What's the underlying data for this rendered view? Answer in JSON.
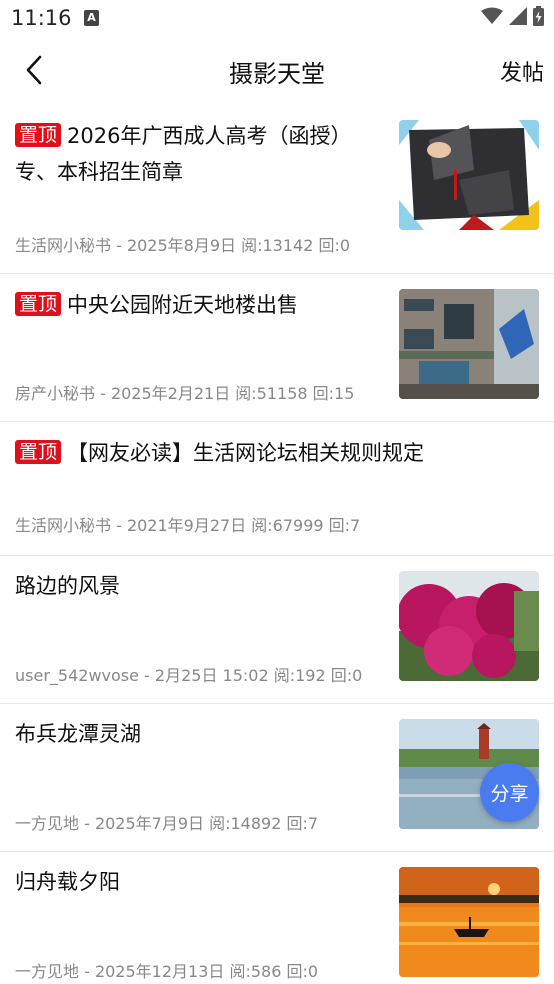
{
  "status_bar": {
    "time": "11:16",
    "notification_icon_letter": "A",
    "icons": [
      "wifi-icon",
      "signal-icon",
      "battery-charging-icon"
    ]
  },
  "app_bar": {
    "title": "摄影天堂",
    "action_label": "发帖"
  },
  "pin_label": "置顶",
  "posts": [
    {
      "pinned": true,
      "title": "2026年广西成人高考（函授）专、本科招生简章",
      "meta": "生活网小秘书 - 2025年8月9日  阅:13142  回:0",
      "has_thumb": true
    },
    {
      "pinned": true,
      "title": "中央公园附近天地楼出售",
      "meta": "房产小秘书 - 2025年2月21日  阅:51158  回:15",
      "has_thumb": true
    },
    {
      "pinned": true,
      "title": "【网友必读】生活网论坛相关规则规定",
      "meta": "生活网小秘书 - 2021年9月27日  阅:67999  回:7",
      "has_thumb": false
    },
    {
      "pinned": false,
      "title": "路边的风景",
      "meta": "user_542wvose - 2月25日 15:02  阅:192  回:0",
      "has_thumb": true
    },
    {
      "pinned": false,
      "title": "布兵龙潭灵湖",
      "meta": "一方见地 - 2025年7月9日  阅:14892  回:7",
      "has_thumb": true
    },
    {
      "pinned": false,
      "title": "归舟载夕阳",
      "meta": "一方见地 - 2025年12月13日  阅:586  回:0",
      "has_thumb": true
    }
  ],
  "share_button": "分享",
  "colors": {
    "pin_bg": "#e0101b",
    "share_bg": "#4a7cf0",
    "meta_text": "#888888"
  }
}
